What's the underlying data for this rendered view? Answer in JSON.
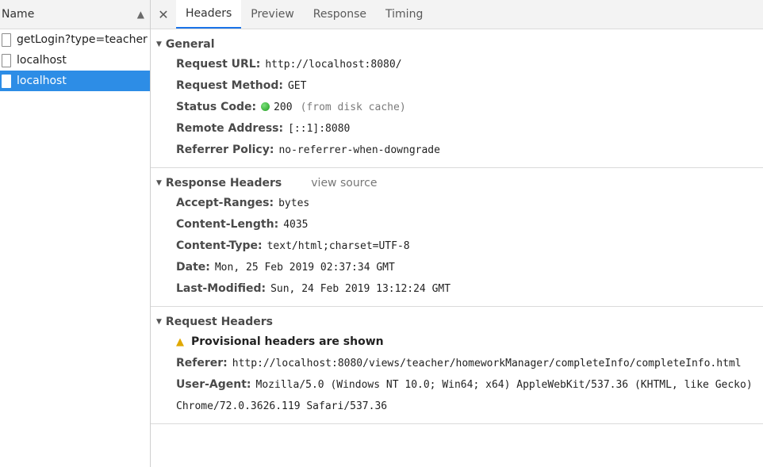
{
  "list": {
    "header": "Name",
    "sort_icon": "triangle-up-icon",
    "items": [
      {
        "label": "getLogin?type=teacher"
      },
      {
        "label": "localhost"
      },
      {
        "label": "localhost"
      }
    ]
  },
  "tabs": {
    "close_icon": "close-icon",
    "items": [
      {
        "label": "Headers"
      },
      {
        "label": "Preview"
      },
      {
        "label": "Response"
      },
      {
        "label": "Timing"
      }
    ]
  },
  "general": {
    "title": "General",
    "rows": [
      {
        "key": "Request URL:",
        "value": "http://localhost:8080/"
      },
      {
        "key": "Request Method:",
        "value": "GET"
      },
      {
        "key": "Status Code:",
        "value": "200",
        "extra": "(from disk cache)"
      },
      {
        "key": "Remote Address:",
        "value": "[::1]:8080"
      },
      {
        "key": "Referrer Policy:",
        "value": "no-referrer-when-downgrade"
      }
    ]
  },
  "response_headers": {
    "title": "Response Headers",
    "view_source": "view source",
    "rows": [
      {
        "key": "Accept-Ranges:",
        "value": "bytes"
      },
      {
        "key": "Content-Length:",
        "value": "4035"
      },
      {
        "key": "Content-Type:",
        "value": "text/html;charset=UTF-8"
      },
      {
        "key": "Date:",
        "value": "Mon, 25 Feb 2019 02:37:34 GMT"
      },
      {
        "key": "Last-Modified:",
        "value": "Sun, 24 Feb 2019 13:12:24 GMT"
      }
    ]
  },
  "request_headers": {
    "title": "Request Headers",
    "warning": "Provisional headers are shown",
    "rows": [
      {
        "key": "Referer:",
        "value": "http://localhost:8080/views/teacher/homeworkManager/completeInfo/completeInfo.html"
      },
      {
        "key": "User-Agent:",
        "value": "Mozilla/5.0 (Windows NT 10.0; Win64; x64) AppleWebKit/537.36 (KHTML, like Gecko) Chrome/72.0.3626.119 Safari/537.36"
      }
    ]
  },
  "colors": {
    "selected_row": "#2d8de6",
    "active_tab_underline": "#1a73e8",
    "status_ok": "#1f9d1f",
    "warning": "#e0a800"
  }
}
